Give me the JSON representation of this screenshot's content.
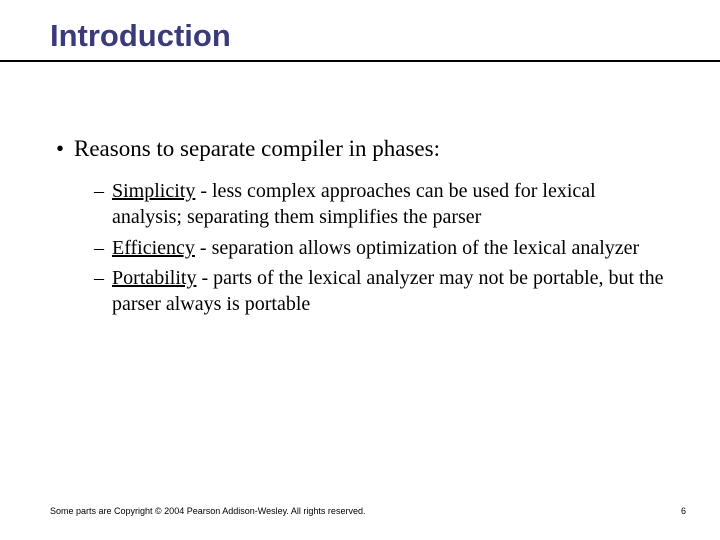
{
  "title": "Introduction",
  "main_point": {
    "bullet": "•",
    "text": "Reasons to separate compiler in phases:"
  },
  "sub_points": [
    {
      "dash": "–",
      "term": "Simplicity",
      "rest": " - less complex approaches can be used for lexical analysis; separating them simplifies the parser"
    },
    {
      "dash": "–",
      "term": "Efficiency",
      "rest": " - separation allows optimization of the lexical analyzer"
    },
    {
      "dash": "–",
      "term": "Portability",
      "rest": " - parts of the lexical analyzer may not be portable, but the parser always is portable"
    }
  ],
  "footer": "Some parts are Copyright © 2004 Pearson Addison-Wesley. All rights reserved.",
  "page_number": "6"
}
